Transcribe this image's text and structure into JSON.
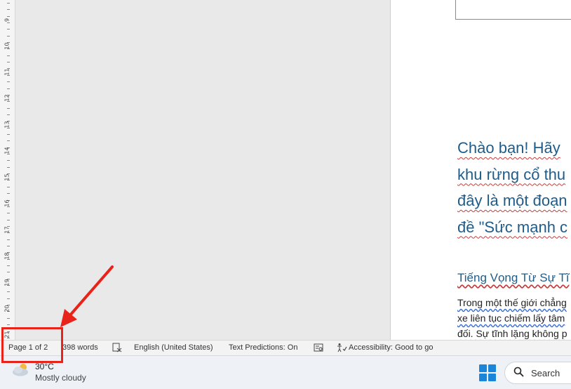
{
  "ruler": {
    "labels": [
      "9",
      "10",
      "11",
      "12",
      "13",
      "14",
      "15",
      "16",
      "17",
      "18",
      "19",
      "20",
      "21"
    ]
  },
  "document": {
    "heading_lines": [
      "Chào bạn! Hãy",
      "khu rừng cổ thu",
      "đây là một đoạn",
      "đề \"Sức mạnh c"
    ],
    "subheading": "Tiếng Vọng Từ Sự Tĩ",
    "body_lines": [
      "Trong một thế giới chẳng",
      "xe liên tục chiếm lấy tâm",
      "đối. Sự tĩnh lặng không p"
    ]
  },
  "statusbar": {
    "page": "Page 1 of 2",
    "words": "398 words",
    "language": "English (United States)",
    "text_predictions": "Text Predictions: On",
    "accessibility": "Accessibility: Good to go"
  },
  "taskbar": {
    "temperature": "30°C",
    "weather": "Mostly cloudy",
    "search_label": "Search"
  },
  "colors": {
    "annotation": "#e8231a",
    "heading": "#1f5c8a",
    "windows_blue": "#1a86d9"
  }
}
